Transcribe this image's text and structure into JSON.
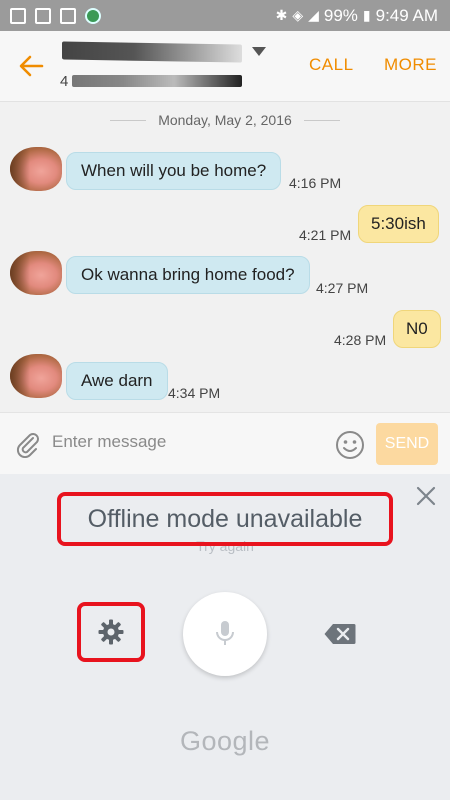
{
  "status_bar": {
    "battery": "99%",
    "time": "9:49 AM",
    "icons": [
      "image-icon",
      "download-icon",
      "photo-icon",
      "shield-icon",
      "bluetooth-icon",
      "wifi-icon",
      "signal-icon",
      "battery-icon"
    ]
  },
  "header": {
    "contact_number_prefix": "4",
    "call_label": "CALL",
    "more_label": "MORE",
    "accent_color": "#f08c00"
  },
  "conversation": {
    "date": "Monday, May 2, 2016",
    "messages": [
      {
        "direction": "incoming",
        "text": "When will you be home?",
        "time": "4:16 PM"
      },
      {
        "direction": "outgoing",
        "text": "5:30ish",
        "time": "4:21 PM"
      },
      {
        "direction": "incoming",
        "text": "Ok wanna bring home food?",
        "time": "4:27 PM"
      },
      {
        "direction": "outgoing",
        "text": "N0",
        "time": "4:28 PM"
      },
      {
        "direction": "incoming",
        "text": "Awe darn",
        "time": "4:34 PM"
      }
    ]
  },
  "composer": {
    "placeholder": "Enter message",
    "send_label": "SEND"
  },
  "voice_panel": {
    "title": "Offline mode unavailable",
    "subtitle": "Try again",
    "brand": "Google",
    "highlight_color": "#e8131e"
  }
}
